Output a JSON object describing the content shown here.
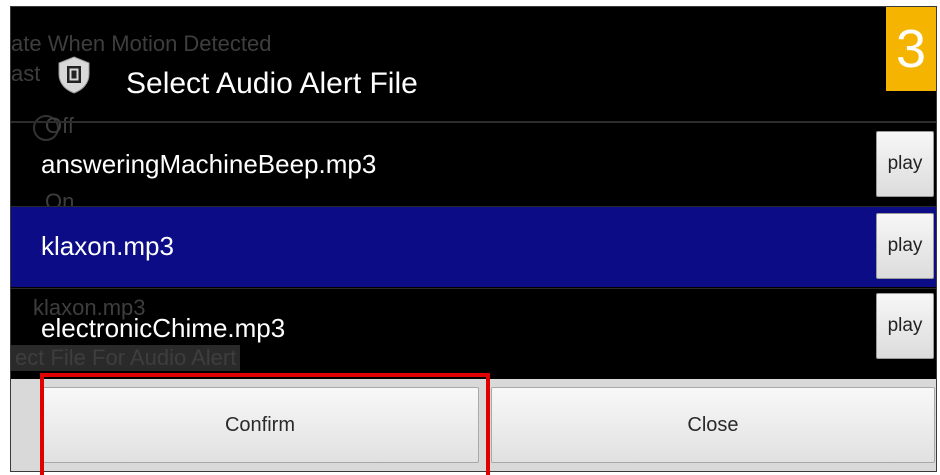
{
  "background_app": {
    "line1": "ate When Motion Detected",
    "line2": "ast",
    "option_off": "Off",
    "option_on": "On",
    "current_file": "klaxon.mp3",
    "section_label": "ect File For Audio Alert",
    "bottom_fragment": "· ·"
  },
  "dialog": {
    "title": "Select Audio Alert File",
    "icon": "shield-icon",
    "step_number": "3",
    "files": [
      {
        "name": "answeringMachineBeep.mp3",
        "play_label": "play",
        "selected": false
      },
      {
        "name": "klaxon.mp3",
        "play_label": "play",
        "selected": true
      },
      {
        "name": "electronicChime.mp3",
        "play_label": "play",
        "selected": false
      }
    ],
    "confirm_label": "Confirm",
    "close_label": "Close"
  },
  "colors": {
    "selected_row": "#0c0c86",
    "step_badge": "#f5b400",
    "highlight": "#e10000"
  }
}
